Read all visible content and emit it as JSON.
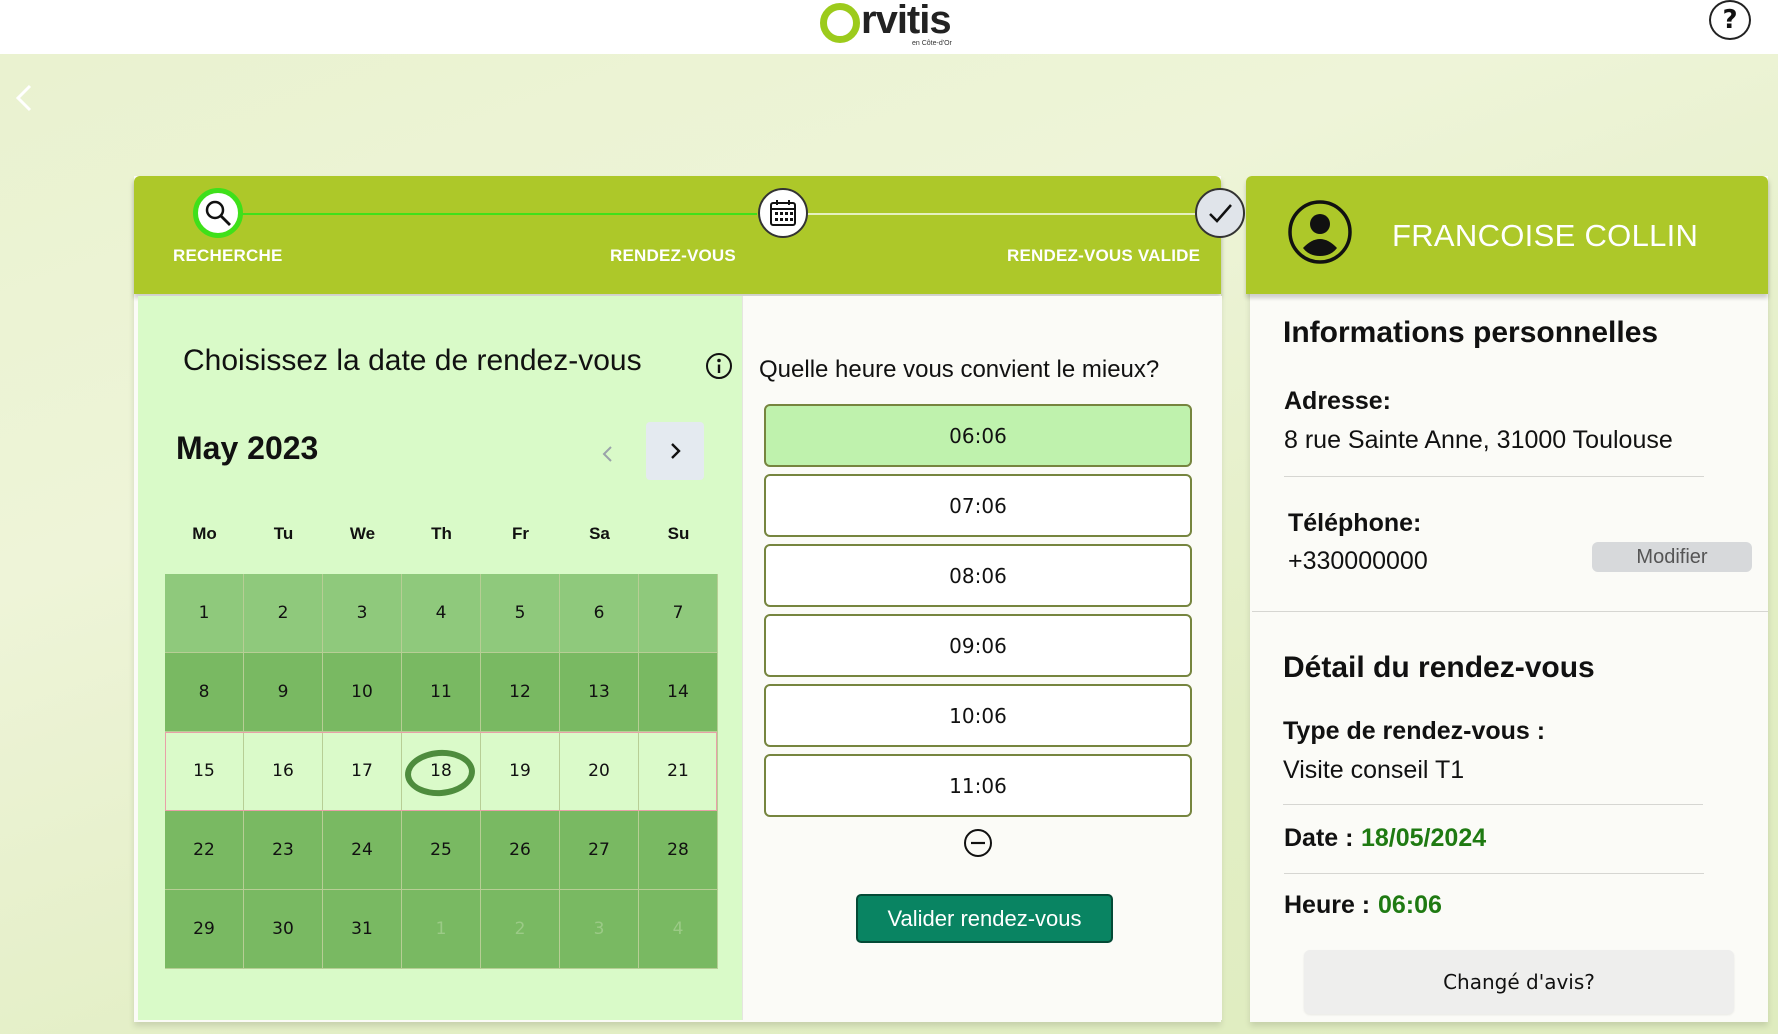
{
  "header": {
    "logo_text": "rvitis",
    "logo_sub": "en Côte-d'Or",
    "help_label": "?"
  },
  "stepper": {
    "steps": [
      {
        "label": "RECHERCHE",
        "icon": "search-icon",
        "state": "active"
      },
      {
        "label": "RENDEZ-VOUS",
        "icon": "calendar-icon",
        "state": "current"
      },
      {
        "label": "RENDEZ-VOUS VALIDE",
        "icon": "check-icon",
        "state": "pending"
      }
    ]
  },
  "calendar": {
    "title": "Choisissez la date de rendez-vous",
    "month_label": "May 2023",
    "weekdays": [
      "Mo",
      "Tu",
      "We",
      "Th",
      "Fr",
      "Sa",
      "Su"
    ],
    "weeks": [
      [
        "1",
        "2",
        "3",
        "4",
        "5",
        "6",
        "7"
      ],
      [
        "8",
        "9",
        "10",
        "11",
        "12",
        "13",
        "14"
      ],
      [
        "15",
        "16",
        "17",
        "18",
        "19",
        "20",
        "21"
      ],
      [
        "22",
        "23",
        "24",
        "25",
        "26",
        "27",
        "28"
      ],
      [
        "29",
        "30",
        "31",
        "1",
        "2",
        "3",
        "4"
      ]
    ],
    "selected_day": "18"
  },
  "times": {
    "question": "Quelle heure vous convient le mieux?",
    "slots": [
      "06:06",
      "07:06",
      "08:06",
      "09:06",
      "10:06",
      "11:06"
    ],
    "selected": "06:06",
    "validate_label": "Valider rendez-vous"
  },
  "profile": {
    "name": "FRANCOISE COLLIN",
    "personal_heading": "Informations personnelles",
    "address_label": "Adresse:",
    "address": "8 rue Sainte Anne, 31000 Toulouse",
    "phone_label": "Téléphone:",
    "phone": "+330000000",
    "modify_label": "Modifier"
  },
  "appointment": {
    "heading": "Détail du rendez-vous",
    "type_label": "Type de rendez-vous :",
    "type": "Visite conseil T1",
    "date_label": "Date :",
    "date": "18/05/2024",
    "time_label": "Heure :",
    "time": "06:06",
    "change_label": "Changé d'avis?"
  },
  "colors": {
    "accent": "#adc829",
    "selected_slot": "#bff2ad",
    "validate": "#098462",
    "value_green": "#1f7a12"
  }
}
